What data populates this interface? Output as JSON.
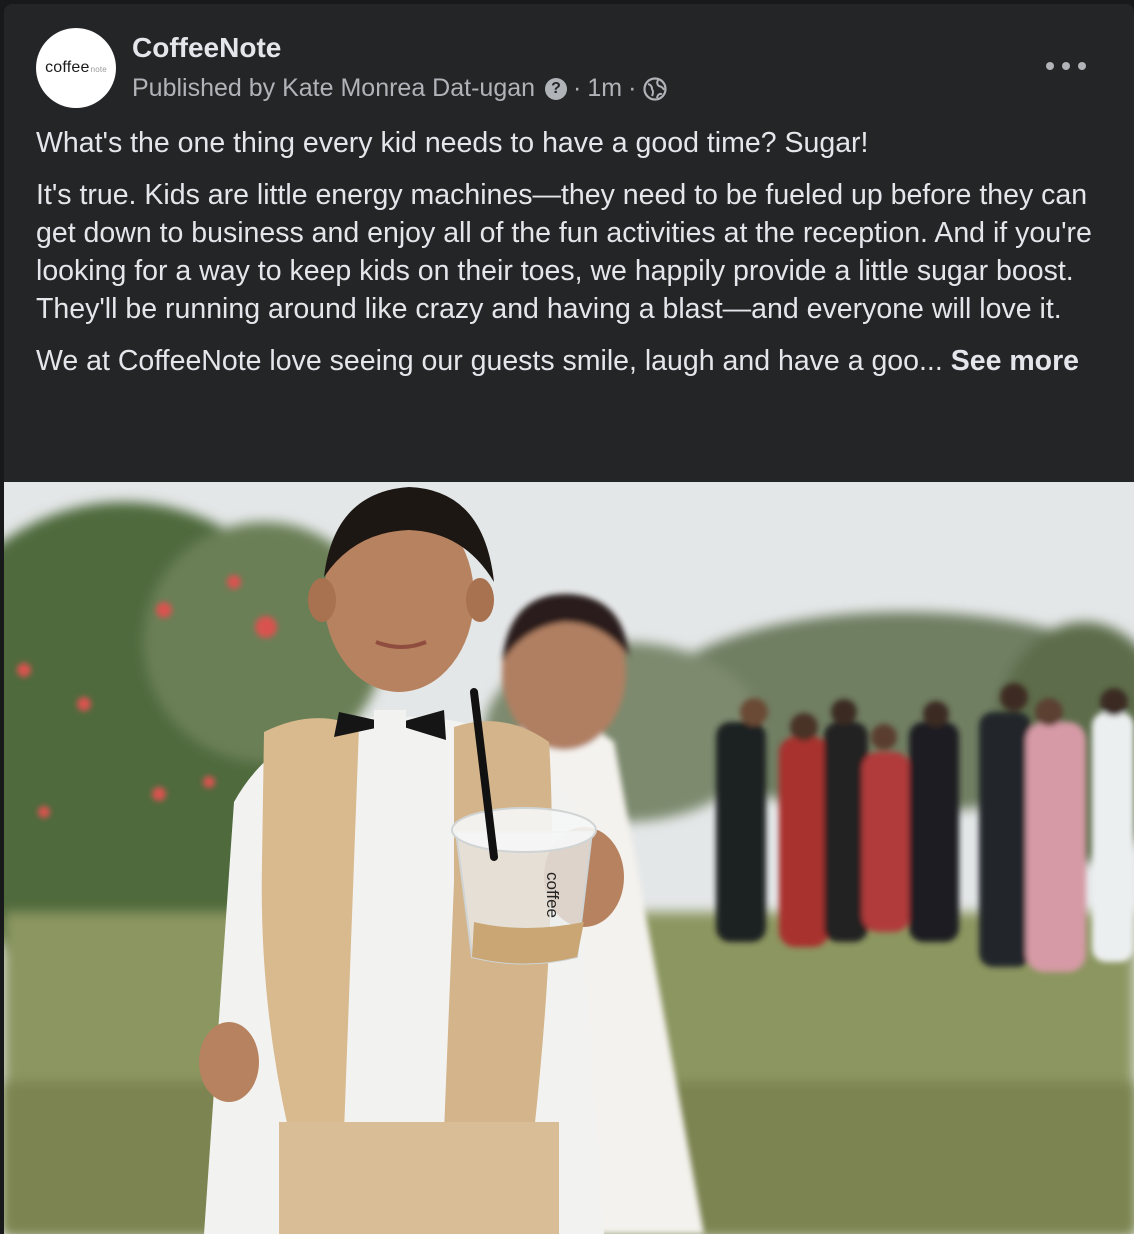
{
  "post": {
    "page_name": "CoffeeNote",
    "avatar_text": "coffee",
    "avatar_small_text": "note",
    "published_by": "Published by Kate Monrea Dat-ugan",
    "help_glyph": "?",
    "time": "1m",
    "separator": "·",
    "audience_icon": "globe-icon",
    "more_icon": "more-horizontal-icon",
    "paragraphs": [
      "What's the one thing every kid needs to have a good time? Sugar!",
      "It's true. Kids are little energy machines—they need to be fueled up  before they can get down to business and enjoy all of the fun activities at the reception. And if you're looking for a way to keep kids on their toes, we happily provide a little sugar boost.  They'll be running around like crazy and having a blast—and everyone will love it."
    ],
    "truncated_text": "We at CoffeeNote love seeing our guests smile, laugh and have a goo...",
    "see_more_label": "See more",
    "cup_text": "coffee"
  },
  "colors": {
    "background": "#18191a",
    "card": "#242526",
    "primary_text": "#e4e6eb",
    "secondary_text": "#b0b3b8"
  }
}
